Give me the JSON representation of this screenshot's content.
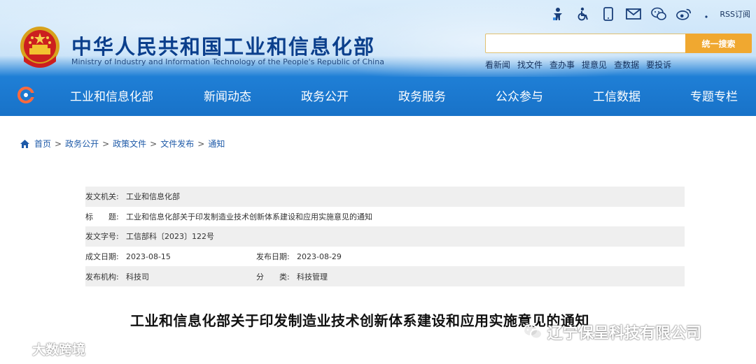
{
  "header": {
    "title": "中华人民共和国工业和信息化部",
    "subtitle": "Ministry of Industry and Information Technology of the People's Republic of China",
    "top_icons": [
      "accessibility-figure-icon",
      "wheelchair-icon",
      "mobile-icon",
      "mail-icon",
      "wechat-icon",
      "weibo-icon",
      "rss-icon"
    ],
    "rss_label": "RSS订阅",
    "search": {
      "value": "",
      "button_label": "统一搜索"
    },
    "quick_links": [
      "看新闻",
      "找文件",
      "查办事",
      "提意见",
      "查数据",
      "要投诉"
    ],
    "nav": [
      "工业和信息化部",
      "新闻动态",
      "政务公开",
      "政务服务",
      "公众参与",
      "工信数据",
      "专题专栏"
    ],
    "colors": {
      "nav_blue": "#1872c8",
      "title_blue": "#0b3f8c",
      "search_orange": "#f0a830"
    }
  },
  "breadcrumb": [
    "首页",
    "政务公开",
    "政策文件",
    "文件发布",
    "通知"
  ],
  "meta": {
    "issuer_label": "发文机关:",
    "issuer": "工业和信息化部",
    "title_label": "标　　题:",
    "title": "工业和信息化部关于印发制造业技术创新体系建设和应用实施意见的通知",
    "docno_label": "发文字号:",
    "docno": "工信部科〔2023〕122号",
    "written_label": "成文日期:",
    "written": "2023-08-15",
    "published_label": "发布日期:",
    "published": "2023-08-29",
    "org_label": "发布机构:",
    "org": "科技司",
    "category_label": "分　　类:",
    "category": "科技管理"
  },
  "document_title": "工业和信息化部关于印发制造业技术创新体系建设和应用实施意见的通知",
  "watermarks": {
    "left": "大数跨境",
    "right": "辽宁保呈科技有限公司"
  }
}
